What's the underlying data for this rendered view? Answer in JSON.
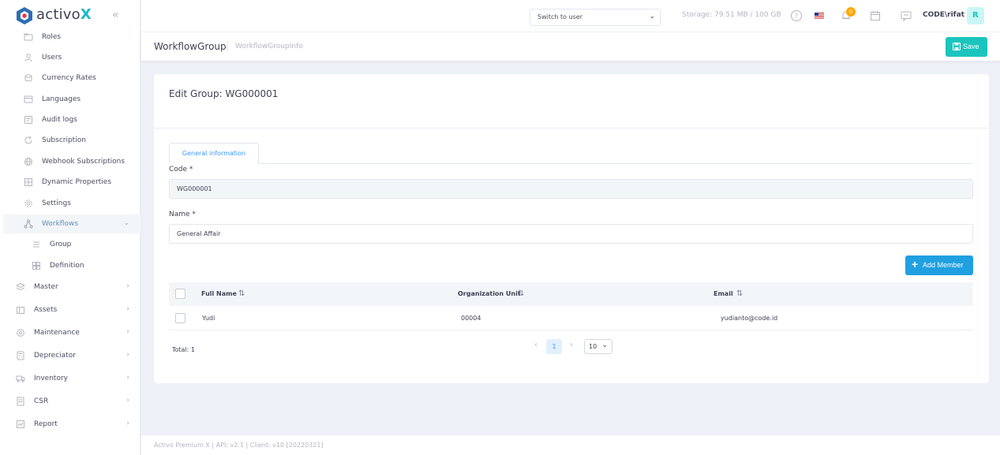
{
  "brand": {
    "name_part1": "activo",
    "name_part2": "X"
  },
  "sidebar": {
    "items": [
      {
        "label": "Roles"
      },
      {
        "label": "Users"
      },
      {
        "label": "Currency Rates"
      },
      {
        "label": "Languages"
      },
      {
        "label": "Audit logs"
      },
      {
        "label": "Subscription"
      },
      {
        "label": "Webhook Subscriptions"
      },
      {
        "label": "Dynamic Properties"
      },
      {
        "label": "Settings"
      },
      {
        "label": "Workflows"
      }
    ],
    "sub_items": [
      {
        "label": "Group"
      },
      {
        "label": "Definition"
      }
    ],
    "top_items": [
      {
        "label": "Master"
      },
      {
        "label": "Assets"
      },
      {
        "label": "Maintenance"
      },
      {
        "label": "Depreciator"
      },
      {
        "label": "Inventory"
      },
      {
        "label": "CSR"
      },
      {
        "label": "Report"
      }
    ]
  },
  "header": {
    "switch_user": "Switch to user",
    "storage": "Storage: 79.51 MB / 100 GB",
    "notification_count": "0",
    "tenant": "CODE\\rifat",
    "avatar_initial": "R"
  },
  "subheader": {
    "title": "WorkflowGroup",
    "breadcrumb": "WorkflowGroupInfo",
    "save_label": "Save"
  },
  "card": {
    "title": "Edit Group: WG000001",
    "tab_label": "General information",
    "code_label": "Code *",
    "code_value": "WG000001",
    "name_label": "Name *",
    "name_value": "General Affair",
    "add_member_label": "Add Member"
  },
  "table": {
    "columns": [
      "Full Name",
      "Organization Unit",
      "Email"
    ],
    "rows": [
      {
        "full_name": "Yudi",
        "org_unit": "00004",
        "email": "yudianto@code.id"
      }
    ],
    "total": "Total: 1",
    "current_page": "1",
    "page_size": "10"
  },
  "footer": {
    "text": "Activo Premium X | API: v2.1 | Client: v10 [20220321]"
  },
  "colors": {
    "accent": "#1bc5bd",
    "primary": "#20a0e0",
    "brand": "#20b8c8"
  }
}
